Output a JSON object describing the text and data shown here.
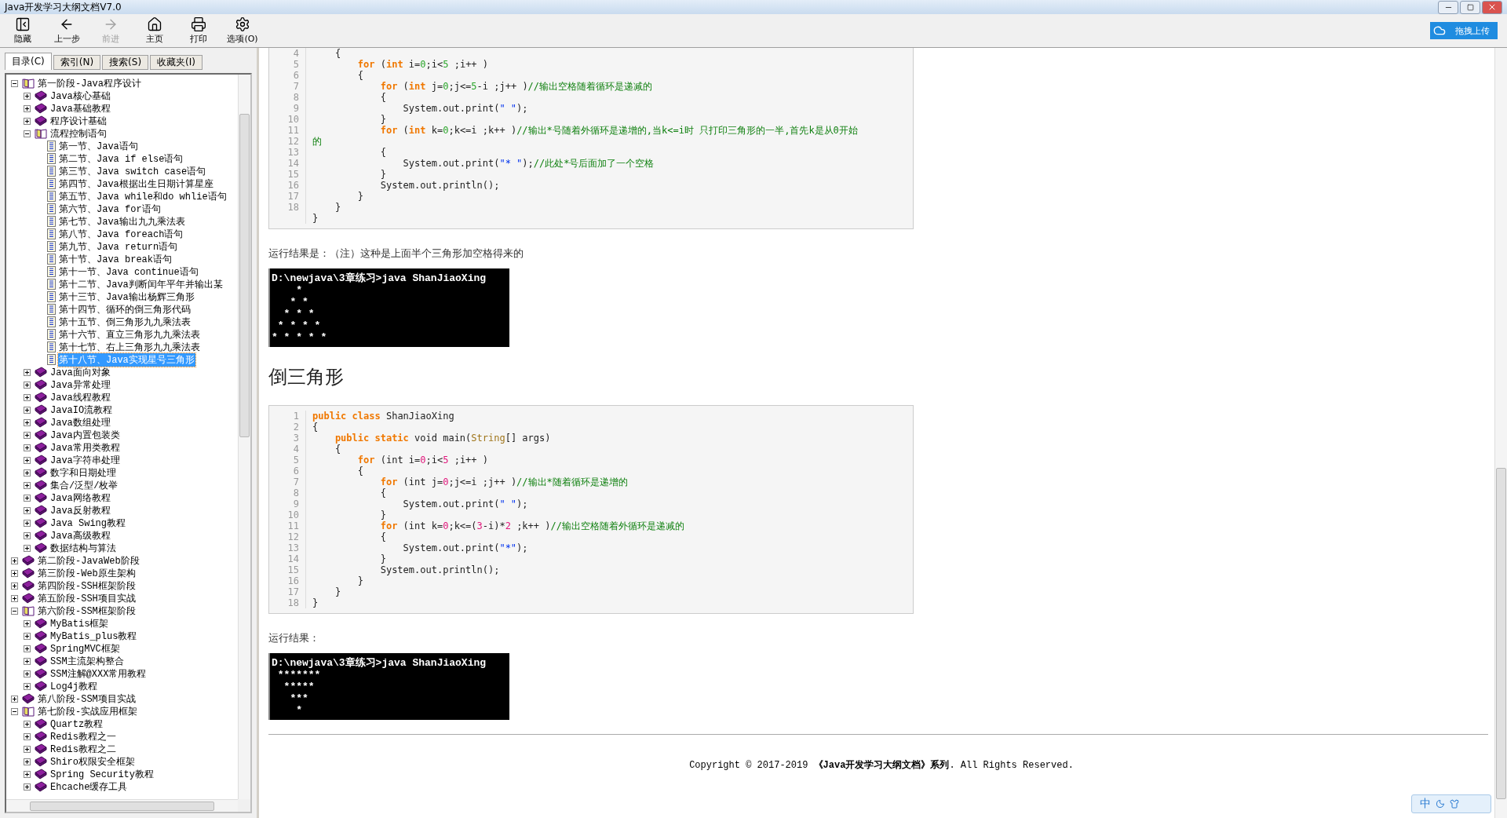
{
  "window": {
    "title": "Java开发学习大纲文档V7.0"
  },
  "toolbar": [
    {
      "label": "隐藏",
      "disabled": false
    },
    {
      "label": "上一步",
      "disabled": false
    },
    {
      "label": "前进",
      "disabled": true
    },
    {
      "label": "主页",
      "disabled": false
    },
    {
      "label": "打印",
      "disabled": false
    },
    {
      "label": "选项(O)",
      "disabled": false
    }
  ],
  "upload_button": "拖拽上传",
  "tabs": [
    {
      "label": "目录(C)",
      "selected": true
    },
    {
      "label": "索引(N)",
      "selected": false
    },
    {
      "label": "搜索(S)",
      "selected": false
    },
    {
      "label": "收藏夹(I)",
      "selected": false
    }
  ],
  "tree": [
    {
      "label": "第一阶段-Java程序设计",
      "kind": "book",
      "expanded": true,
      "selected": false,
      "children": [
        {
          "label": "Java核心基础",
          "kind": "book",
          "expanded": false,
          "selected": false
        },
        {
          "label": "Java基础教程",
          "kind": "book",
          "expanded": false,
          "selected": false
        },
        {
          "label": "程序设计基础",
          "kind": "book",
          "expanded": false,
          "selected": false
        },
        {
          "label": "流程控制语句",
          "kind": "book",
          "expanded": true,
          "selected": false,
          "children": [
            {
              "label": "第一节、Java语句",
              "kind": "page",
              "selected": false
            },
            {
              "label": "第二节、Java if else语句",
              "kind": "page",
              "selected": false
            },
            {
              "label": "第三节、Java switch case语句",
              "kind": "page",
              "selected": false
            },
            {
              "label": "第四节、Java根据出生日期计算星座",
              "kind": "page",
              "selected": false
            },
            {
              "label": "第五节、Java while和do whlie语句",
              "kind": "page",
              "selected": false
            },
            {
              "label": "第六节、Java for语句",
              "kind": "page",
              "selected": false
            },
            {
              "label": "第七节、Java输出九九乘法表",
              "kind": "page",
              "selected": false
            },
            {
              "label": "第八节、Java foreach语句",
              "kind": "page",
              "selected": false
            },
            {
              "label": "第九节、Java return语句",
              "kind": "page",
              "selected": false
            },
            {
              "label": "第十节、Java break语句",
              "kind": "page",
              "selected": false
            },
            {
              "label": "第十一节、Java continue语句",
              "kind": "page",
              "selected": false
            },
            {
              "label": "第十二节、Java判断闰年平年并输出某",
              "kind": "page",
              "selected": false
            },
            {
              "label": "第十三节、Java输出杨辉三角形",
              "kind": "page",
              "selected": false
            },
            {
              "label": "第十四节、循环的倒三角形代码",
              "kind": "page",
              "selected": false
            },
            {
              "label": "第十五节、倒三角形九九乘法表",
              "kind": "page",
              "selected": false
            },
            {
              "label": "第十六节、直立三角形九九乘法表",
              "kind": "page",
              "selected": false
            },
            {
              "label": "第十七节、右上三角形九九乘法表",
              "kind": "page",
              "selected": false
            },
            {
              "label": "第十八节、Java实现星号三角形",
              "kind": "page",
              "selected": true
            }
          ]
        },
        {
          "label": "Java面向对象",
          "kind": "book",
          "expanded": false,
          "selected": false
        },
        {
          "label": "Java异常处理",
          "kind": "book",
          "expanded": false,
          "selected": false
        },
        {
          "label": "Java线程教程",
          "kind": "book",
          "expanded": false,
          "selected": false
        },
        {
          "label": "JavaIO流教程",
          "kind": "book",
          "expanded": false,
          "selected": false
        },
        {
          "label": "Java数组处理",
          "kind": "book",
          "expanded": false,
          "selected": false
        },
        {
          "label": "Java内置包装类",
          "kind": "book",
          "expanded": false,
          "selected": false
        },
        {
          "label": "Java常用类教程",
          "kind": "book",
          "expanded": false,
          "selected": false
        },
        {
          "label": "Java字符串处理",
          "kind": "book",
          "expanded": false,
          "selected": false
        },
        {
          "label": "数字和日期处理",
          "kind": "book",
          "expanded": false,
          "selected": false
        },
        {
          "label": "集合/泛型/枚举",
          "kind": "book",
          "expanded": false,
          "selected": false
        },
        {
          "label": "Java网络教程",
          "kind": "book",
          "expanded": false,
          "selected": false
        },
        {
          "label": "Java反射教程",
          "kind": "book",
          "expanded": false,
          "selected": false
        },
        {
          "label": "Java Swing教程",
          "kind": "book",
          "expanded": false,
          "selected": false
        },
        {
          "label": "Java高级教程",
          "kind": "book",
          "expanded": false,
          "selected": false
        },
        {
          "label": "数据结构与算法",
          "kind": "book",
          "expanded": false,
          "selected": false
        }
      ]
    },
    {
      "label": "第二阶段-JavaWeb阶段",
      "kind": "book",
      "expanded": false,
      "selected": false
    },
    {
      "label": "第三阶段-Web原生架构",
      "kind": "book",
      "expanded": false,
      "selected": false
    },
    {
      "label": "第四阶段-SSH框架阶段",
      "kind": "book",
      "expanded": false,
      "selected": false
    },
    {
      "label": "第五阶段-SSH项目实战",
      "kind": "book",
      "expanded": false,
      "selected": false
    },
    {
      "label": "第六阶段-SSM框架阶段",
      "kind": "book",
      "expanded": true,
      "selected": false,
      "children": [
        {
          "label": "MyBatis框架",
          "kind": "book",
          "expanded": false,
          "selected": false
        },
        {
          "label": "MyBatis_plus教程",
          "kind": "book",
          "expanded": false,
          "selected": false
        },
        {
          "label": "SpringMVC框架",
          "kind": "book",
          "expanded": false,
          "selected": false
        },
        {
          "label": "SSM主流架构整合",
          "kind": "book",
          "expanded": false,
          "selected": false
        },
        {
          "label": "SSM注解@XXX常用教程",
          "kind": "book",
          "expanded": false,
          "selected": false
        },
        {
          "label": "Log4j教程",
          "kind": "book",
          "expanded": false,
          "selected": false
        }
      ]
    },
    {
      "label": "第八阶段-SSM项目实战",
      "kind": "book",
      "expanded": false,
      "selected": false
    },
    {
      "label": "第七阶段-实战应用框架",
      "kind": "book",
      "expanded": true,
      "selected": false,
      "children": [
        {
          "label": "Quartz教程",
          "kind": "book",
          "expanded": false,
          "selected": false
        },
        {
          "label": "Redis教程之一",
          "kind": "book",
          "expanded": false,
          "selected": false
        },
        {
          "label": "Redis教程之二",
          "kind": "book",
          "expanded": false,
          "selected": false
        },
        {
          "label": "Shiro权限安全框架",
          "kind": "book",
          "expanded": false,
          "selected": false
        },
        {
          "label": "Spring Security教程",
          "kind": "book",
          "expanded": false,
          "selected": false
        },
        {
          "label": "Ehcache缓存工具",
          "kind": "book",
          "expanded": false,
          "selected": false
        }
      ]
    }
  ],
  "content": [
    {
      "kind": "code",
      "line_numbers": [
        "4",
        "5",
        "6",
        "7",
        "8",
        "9",
        "10",
        "11",
        "12",
        "13",
        "14",
        "15",
        "16",
        "17",
        "18"
      ],
      "lines": [
        [
          "    {"
        ],
        [
          {
            "kind": "keyword",
            "text": "        for"
          },
          " (",
          {
            "kind": "keyword",
            "text": "int"
          },
          " i=",
          {
            "kind": "literal",
            "text": "0"
          },
          ";i<",
          {
            "kind": "literal",
            "text": "5"
          },
          " ;i++ )"
        ],
        [
          "        {"
        ],
        [
          {
            "kind": "keyword",
            "text": "            for"
          },
          " (",
          {
            "kind": "keyword",
            "text": "int"
          },
          " j=",
          {
            "kind": "literal",
            "text": "0"
          },
          ";j<=",
          {
            "kind": "literal",
            "text": "5"
          },
          "-i ;j++ )",
          {
            "kind": "comment",
            "text": "//输出空格随着循环是递减的"
          }
        ],
        [
          "            {"
        ],
        [
          "                System.out.print(",
          {
            "kind": "string",
            "text": "\" \""
          },
          ");"
        ],
        [
          "            }"
        ],
        [
          {
            "kind": "keyword",
            "text": "            for"
          },
          " (",
          {
            "kind": "keyword",
            "text": "int"
          },
          " k=",
          {
            "kind": "literal",
            "text": "0"
          },
          ";k<=i ;k++ )",
          {
            "kind": "comment",
            "text": "//输出*号随着外循环是递增的,当k<=i时 只打印三角形的一半,首先k是从0开始"
          }
        ],
        [
          {
            "kind": "comment",
            "text": "的"
          }
        ],
        [
          "            {"
        ],
        [
          "                System.out.print(",
          {
            "kind": "string",
            "text": "\"* \""
          },
          ");",
          {
            "kind": "comment",
            "text": "//此处*号后面加了一个空格"
          }
        ],
        [
          "            }"
        ],
        [
          "            System.out.println();"
        ],
        [
          "        }"
        ],
        [
          "    }"
        ],
        [
          "}"
        ]
      ]
    },
    {
      "kind": "text",
      "text": "运行结果是：（注）这种是上面半个三角形加空格得来的"
    },
    {
      "kind": "console",
      "text": "D:\\newjava\\3章练习>java ShanJiaoXing\n    *\n   * *\n  * * *\n * * * *\n* * * * *"
    },
    {
      "kind": "heading",
      "text": "倒三角形"
    },
    {
      "kind": "code",
      "line_numbers": [
        "1",
        "2",
        "3",
        "4",
        "5",
        "6",
        "7",
        "8",
        "9",
        "10",
        "11",
        "12",
        "13",
        "14",
        "15",
        "16",
        "17",
        "18"
      ],
      "lines": [
        [
          {
            "kind": "keyword",
            "text": "public"
          },
          {
            "kind": "keyword",
            "text": " class"
          },
          " ShanJiaoXing"
        ],
        [
          "{"
        ],
        [
          {
            "kind": "keyword",
            "text": "    public"
          },
          {
            "kind": "keyword",
            "text": " static"
          },
          " void main(",
          {
            "kind": "type",
            "text": "String"
          },
          "[] args)"
        ],
        [
          "    {"
        ],
        [
          {
            "kind": "keyword",
            "text": "        for"
          },
          " (int i=",
          {
            "kind": "number",
            "text": "0"
          },
          ";i<",
          {
            "kind": "number",
            "text": "5"
          },
          " ;i++ )"
        ],
        [
          "        {"
        ],
        [
          {
            "kind": "keyword",
            "text": "            for"
          },
          " (int j=",
          {
            "kind": "number",
            "text": "0"
          },
          ";j<=i ;j++ )",
          {
            "kind": "comment",
            "text": "//输出*随着循环是递增的"
          }
        ],
        [
          "            {"
        ],
        [
          "                System.out.print(",
          {
            "kind": "string",
            "text": "\" \""
          },
          ");"
        ],
        [
          "            }"
        ],
        [
          {
            "kind": "keyword",
            "text": "            for"
          },
          " (int k=",
          {
            "kind": "number",
            "text": "0"
          },
          ";k<=(",
          {
            "kind": "number",
            "text": "3"
          },
          "-i)*",
          {
            "kind": "number",
            "text": "2"
          },
          " ;k++ )",
          {
            "kind": "comment",
            "text": "//输出空格随着外循环是递减的"
          }
        ],
        [
          "            {"
        ],
        [
          "                System.out.print(",
          {
            "kind": "string",
            "text": "\"*\""
          },
          ");"
        ],
        [
          "            }"
        ],
        [
          "            System.out.println();"
        ],
        [
          "        }"
        ],
        [
          "    }"
        ],
        [
          "}"
        ]
      ]
    },
    {
      "kind": "text",
      "text": "运行结果："
    },
    {
      "kind": "console",
      "text": "D:\\newjava\\3章练习>java ShanJiaoXing\n *******\n  *****\n   ***\n    *"
    }
  ],
  "footer": "Copyright © 2017-2019 **《Java开发学习大纲文档》系列**. All Rights Reserved.",
  "ime": "中"
}
